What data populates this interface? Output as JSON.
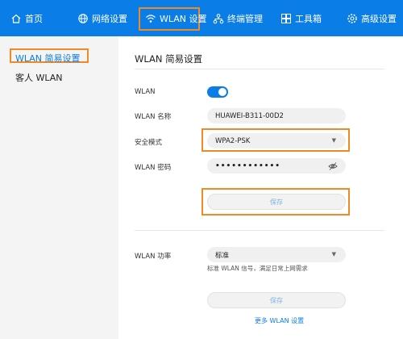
{
  "topbar": {
    "accent": "#0a7de6",
    "items": [
      {
        "label": "首页",
        "icon": "home-icon"
      },
      {
        "label": "网络设置",
        "icon": "globe-icon"
      },
      {
        "label": "WLAN 设置",
        "icon": "wifi-icon"
      },
      {
        "label": "终端管理",
        "icon": "devices-icon"
      },
      {
        "label": "工具箱",
        "icon": "toolbox-icon"
      },
      {
        "label": "高级设置",
        "icon": "gear-icon"
      }
    ],
    "active_index": 2,
    "highlight_color": "#f08a24"
  },
  "sidebar": {
    "items": [
      {
        "label": "WLAN 简易设置",
        "active": true
      },
      {
        "label": "客人 WLAN",
        "active": false
      }
    ]
  },
  "main": {
    "title": "WLAN 简易设置",
    "wlan": {
      "label": "WLAN",
      "enabled": true
    },
    "ssid": {
      "label": "WLAN 名称",
      "value": "HUAWEI-B311-00D2"
    },
    "security": {
      "label": "安全模式",
      "value": "WPA2-PSK"
    },
    "password": {
      "label": "WLAN 密码",
      "value": "••••••••••••",
      "icon": "eye-off-icon"
    },
    "save_label": "保存",
    "power": {
      "label": "WLAN 功率",
      "value": "标准",
      "hint": "标准 WLAN 信号，满足日常上网需求"
    },
    "save2_label": "保存",
    "more_link": "更多 WLAN 设置"
  }
}
